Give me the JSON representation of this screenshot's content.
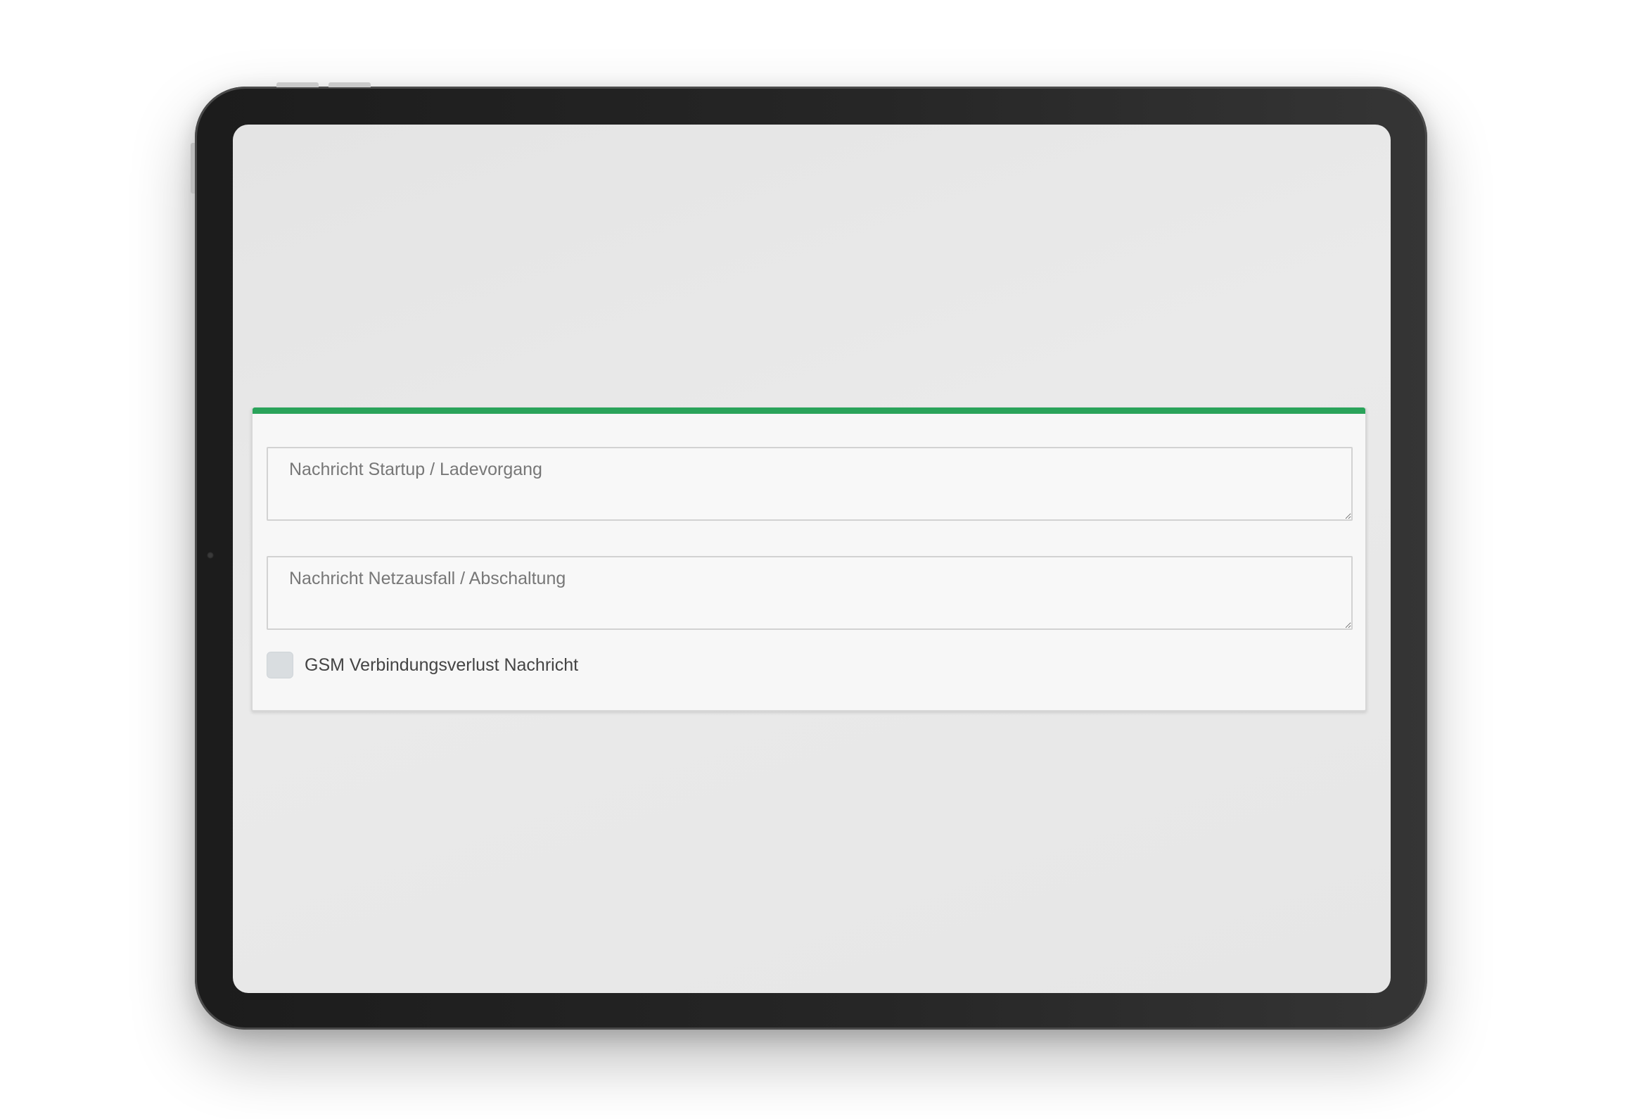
{
  "form": {
    "startup_message_placeholder": "Nachricht Startup / Ladevorgang",
    "startup_message_value": "",
    "power_failure_message_placeholder": "Nachricht Netzausfall / Abschaltung",
    "power_failure_message_value": "",
    "gsm_checkbox_label": "GSM Verbindungsverlust Nachricht",
    "gsm_checkbox_checked": false
  },
  "colors": {
    "accent": "#2aa35a",
    "card_background": "#f7f7f7",
    "screen_background": "#e8e8e8",
    "device_frame": "#262626"
  }
}
